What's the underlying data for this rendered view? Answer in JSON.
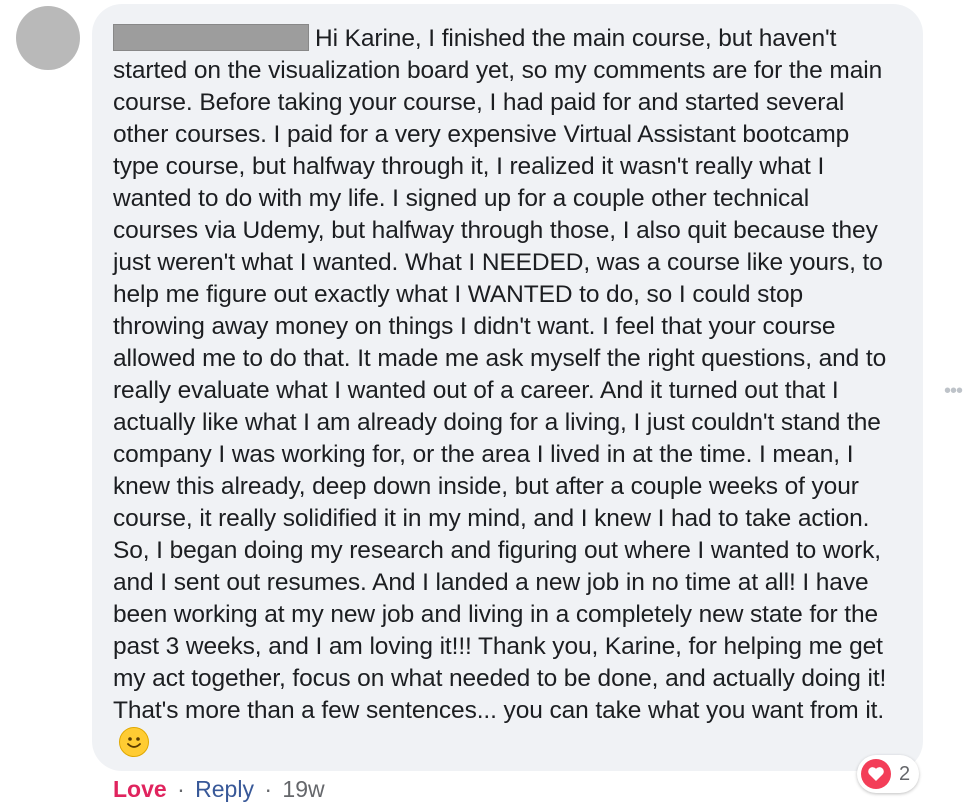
{
  "comment": {
    "author_redacted": true,
    "text": "Hi Karine, I finished the main course, but haven't started on the visualization board yet, so my comments are for the main course. Before taking your course, I had paid for and started several other courses. I paid for a very expensive Virtual Assistant bootcamp type course, but halfway through it, I realized it wasn't really what I wanted to do with my life. I signed up for a couple other technical courses via Udemy, but halfway through those, I also quit because they just weren't what I wanted. What I NEEDED, was a course like yours, to help me figure out exactly what I WANTED to do, so I could stop throwing away money on things I didn't want. I feel that your course allowed me to do that. It made me ask myself the right questions, and to really evaluate what I wanted out of a career. And it turned out that I actually like what I am already doing for a living, I just couldn't stand the company I was working for, or the area I lived in at the time. I mean, I knew this already, deep down inside, but after a couple weeks of your course, it really solidified it in my mind, and I knew I had to take action. So, I began doing my research and figuring out where I wanted to work, and I sent out resumes. And I landed a new job in no time at all! I have been working at my new job and living in a completely new state for the past 3 weeks, and I am loving it!!! Thank you, Karine, for helping me get my act together, focus on what needed to be done, and actually doing it! That's more than a few sentences... you can take what you want from it.",
    "emoji_icon": "smiley-face-icon"
  },
  "actions": {
    "love_label": "Love",
    "separator": "·",
    "reply_label": "Reply",
    "time_ago": "19w"
  },
  "reactions": {
    "icon": "heart-icon",
    "count": "2"
  },
  "colors": {
    "bubble_bg": "#f0f2f5",
    "love": "#e0245e",
    "reply": "#385898",
    "heart": "#f33e58"
  }
}
